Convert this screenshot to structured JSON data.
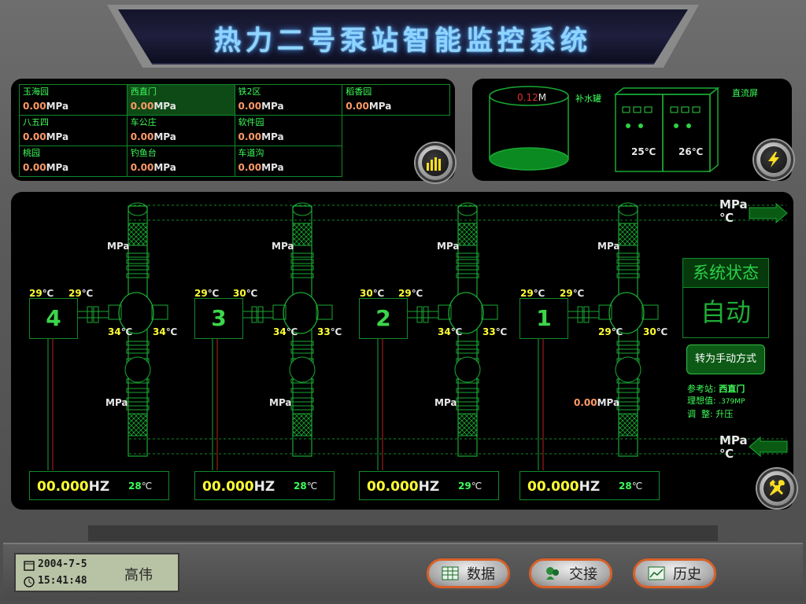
{
  "title": "热力二号泵站智能监控系统",
  "stations": [
    {
      "name": "玉海园",
      "value": "0.00",
      "unit": "MPa"
    },
    {
      "name": "西直门",
      "value": "0.00",
      "unit": "MPa"
    },
    {
      "name": "铁2区",
      "value": "0.00",
      "unit": "MPa"
    },
    {
      "name": "稻香园",
      "value": "0.00",
      "unit": "MPa"
    },
    {
      "name": "八五四",
      "value": "0.00",
      "unit": "MPa"
    },
    {
      "name": "车公庄",
      "value": "0.00",
      "unit": "MPa"
    },
    {
      "name": "软件园",
      "value": "0.00",
      "unit": "MPa"
    },
    {
      "name": "桃园",
      "value": "0.00",
      "unit": "MPa"
    },
    {
      "name": "钓鱼台",
      "value": "0.00",
      "unit": "MPa"
    },
    {
      "name": "车道沟",
      "value": "0.00",
      "unit": "MPa"
    }
  ],
  "tank": {
    "level_value": "0.12",
    "level_unit": "M",
    "label": "补水罐"
  },
  "dc_cabinet": {
    "label": "直流屏",
    "temp1": "25",
    "temp2": "26",
    "temp_unit": "℃"
  },
  "pipes": {
    "unit_mpa": "MPa",
    "unit_c": "℃"
  },
  "pumps": [
    {
      "number": "4",
      "temp_in_left": "29",
      "temp_in_right": "29",
      "temp_out_left": "34",
      "temp_out_right": "34",
      "hz_value": "00.000",
      "hz_unit": "HZ",
      "motor_temp": "28",
      "p_top": "MPa",
      "p_bottom": "MPa"
    },
    {
      "number": "3",
      "temp_in_left": "29",
      "temp_in_right": "30",
      "temp_out_left": "34",
      "temp_out_right": "33",
      "hz_value": "00.000",
      "hz_unit": "HZ",
      "motor_temp": "28",
      "p_top": "MPa",
      "p_bottom": "MPa"
    },
    {
      "number": "2",
      "temp_in_left": "30",
      "temp_in_right": "29",
      "temp_out_left": "34",
      "temp_out_right": "33",
      "hz_value": "00.000",
      "hz_unit": "HZ",
      "motor_temp": "29",
      "p_top": "MPa",
      "p_bottom": "MPa"
    },
    {
      "number": "1",
      "temp_in_left": "29",
      "temp_in_right": "29",
      "temp_out_left": "29",
      "temp_out_right": "30",
      "hz_value": "00.000",
      "hz_unit": "HZ",
      "motor_temp": "28",
      "p_top": "MPa",
      "p_bottom_value": "0.00",
      "p_bottom": "MPa"
    }
  ],
  "temp_unit": "℃",
  "system_status": {
    "heading": "系统状态",
    "value": "自动",
    "switch_label": "转为手动方式"
  },
  "reference": {
    "station_label": "参考站:",
    "station_value": "西直门",
    "ideal_label": "理想值:",
    "ideal_value": ".379MP",
    "adjust_label": "调  整:",
    "adjust_value": "升压"
  },
  "footer": {
    "date": "2004-7-5",
    "time": "15:41:48",
    "user": "高伟",
    "buttons": {
      "data": "数据",
      "handover": "交接",
      "history": "历史"
    }
  },
  "colors": {
    "accent_green": "#3cff5a",
    "value_orange": "#ff9a66",
    "hz_yellow": "#ffff33",
    "title_blue": "#8fd4ff"
  }
}
